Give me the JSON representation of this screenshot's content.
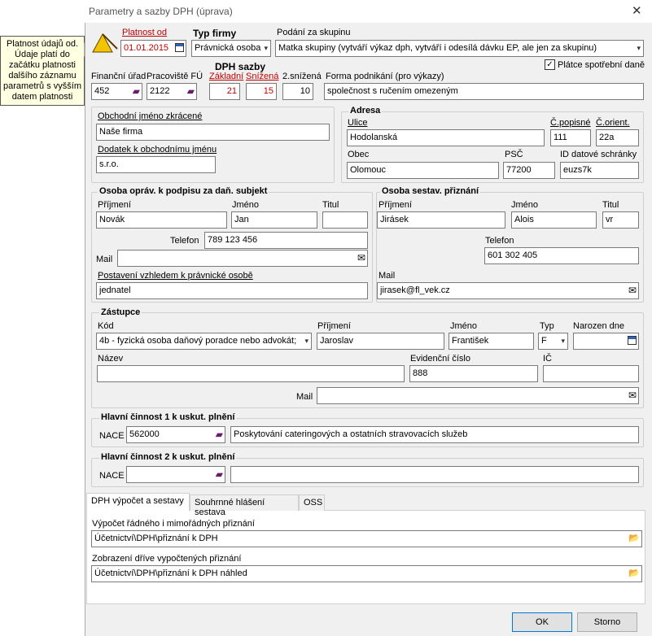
{
  "window": {
    "title": "Parametry a sazby DPH (úprava)",
    "close": "✕"
  },
  "tooltip": {
    "text": "Platnost údajů od. Údaje platí do začátku platnosti dalšího záznamu parametrů s vyšším datem platnosti"
  },
  "header": {
    "platnost_label": "Platnost od",
    "platnost_value": "01.01.2015",
    "typ_firmy_label": "Typ firmy",
    "typ_firmy_value": "Právnická osoba",
    "podani_label": "Podání za skupinu",
    "podani_value": "Matka skupiny (vytváří výkaz dph, vytváří i odesílá dávku EP, ale jen za skupinu)",
    "platce_label": "Plátce spotřební daně",
    "platce_checked": "✓",
    "fu_label": "Finanční úřad",
    "fu_value": "452",
    "pracoviste_label": "Pracoviště FÚ",
    "pracoviste_value": "2122",
    "dph_sazby_label": "DPH sazby",
    "zakladni_label": "Základní",
    "zakladni_value": "21",
    "snizena_label": "Snížená",
    "snizena_value": "15",
    "snizena2_label": "2.snížená",
    "snizena2_value": "10",
    "forma_label": "Forma podnikání (pro výkazy)",
    "forma_value": "společnost s ručením omezeným"
  },
  "firma": {
    "obch_jmeno_label": "Obchodní jméno zkrácené",
    "obch_jmeno_value": "Naše firma",
    "dodatek_label": "Dodatek k obchodnímu jménu",
    "dodatek_value": "s.r.o."
  },
  "adresa": {
    "title": "Adresa",
    "ulice_label": "Ulice",
    "ulice_value": "Hodolanská",
    "cpop_label": "Č.popisné",
    "cpop_value": "111",
    "corient_label": "Č.orient.",
    "corient_value": "22a",
    "obec_label": "Obec",
    "obec_value": "Olomouc",
    "psc_label": "PSČ",
    "psc_value": "77200",
    "ds_label": "ID datové schránky",
    "ds_value": "euzs7k"
  },
  "osoba_podpis": {
    "title": "Osoba opráv. k podpisu za daň. subjekt",
    "prijmeni_label": "Příjmení",
    "prijmeni_value": "Novák",
    "jmeno_label": "Jméno",
    "jmeno_value": "Jan",
    "titul_label": "Titul",
    "titul_value": "",
    "telefon_label": "Telefon",
    "telefon_value": "789 123 456",
    "mail_label": "Mail",
    "mail_value": "",
    "postaveni_label": "Postavení vzhledem k právnické osobě",
    "postaveni_value": "jednatel"
  },
  "osoba_sestav": {
    "title": "Osoba sestav. přiznání",
    "prijmeni_label": "Příjmení",
    "prijmeni_value": "Jirásek",
    "jmeno_label": "Jméno",
    "jmeno_value": "Alois",
    "titul_label": "Titul",
    "titul_value": "vr",
    "telefon_label": "Telefon",
    "telefon_value": "601 302 405",
    "mail_label": "Mail",
    "mail_value": "jirasek@fl_vek.cz"
  },
  "zastupce": {
    "title": "Zástupce",
    "kod_label": "Kód",
    "kod_value": "4b - fyzická osoba daňový poradce nebo advokát;",
    "prijmeni_label": "Příjmení",
    "prijmeni_value": "Jaroslav",
    "jmeno_label": "Jméno",
    "jmeno_value": "František",
    "typ_label": "Typ",
    "typ_value": "F",
    "narozen_label": "Narozen dne",
    "narozen_value": "",
    "nazev_label": "Název",
    "nazev_value": "",
    "evid_label": "Evidenční číslo",
    "evid_value": "888",
    "ic_label": "IČ",
    "ic_value": "",
    "mail_label": "Mail",
    "mail_value": ""
  },
  "cinnost1": {
    "title": "Hlavní činnost 1 k uskut. plnění",
    "nace_label": "NACE",
    "nace_value": "562000",
    "popis_value": "Poskytování cateringových a ostatních stravovacích služeb"
  },
  "cinnost2": {
    "title": "Hlavní činnost 2 k uskut. plnění",
    "nace_label": "NACE",
    "nace_value": "",
    "popis_value": ""
  },
  "tabs": [
    {
      "label": "DPH výpočet a sestavy"
    },
    {
      "label": "Souhrnné hlášení sestava"
    },
    {
      "label": "OSS"
    }
  ],
  "tab_content": {
    "vypocet_label": "Výpočet řádného i mimořádných přiznání",
    "vypocet_value": "Účetnictví\\DPH\\přiznání k DPH",
    "zobrazeni_label": "Zobrazení dříve vypočtených přiznání",
    "zobrazeni_value": "Účetnictví\\DPH\\přiznání k DPH náhled"
  },
  "buttons": {
    "ok": "OK",
    "storno": "Storno"
  },
  "icons": {
    "mail": "✉",
    "book": "▰",
    "folder": "📂",
    "arrow": "▾"
  }
}
